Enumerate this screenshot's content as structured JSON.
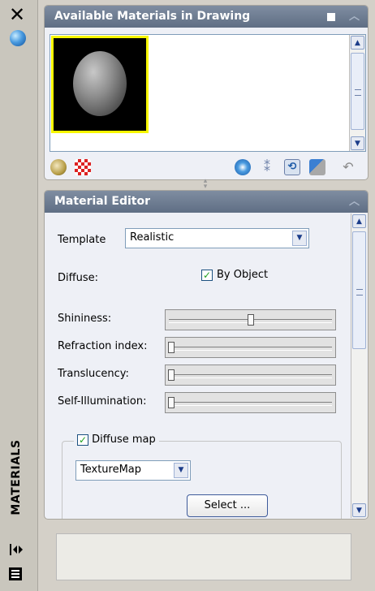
{
  "strip": {
    "close_glyph": "✕",
    "title": "MATERIALS",
    "icons": [
      "close-icon",
      "materials-globe-icon",
      "auto-hide-icon",
      "properties-menu-icon"
    ]
  },
  "available_materials": {
    "title": "Available Materials in Drawing",
    "swatch_selected": "Global",
    "accent_color": "#f7f700",
    "toolbar_icons": [
      "create-material-icon",
      "checker-icon",
      "apply-material-icon",
      "purge-icon",
      "sync-icon",
      "attach-by-layer-icon",
      "undo-icon"
    ]
  },
  "material_editor": {
    "title": "Material Editor",
    "template_label": "Template",
    "template_value": "Realistic",
    "diffuse_label": "Diffuse:",
    "by_object_label": "By Object",
    "by_object_checked": true,
    "sliders": [
      {
        "label": "Shininess:",
        "value": 0.5
      },
      {
        "label": "Refraction index:",
        "value": 0.0
      },
      {
        "label": "Translucency:",
        "value": 0.0
      },
      {
        "label": "Self-Illumination:",
        "value": 0.0
      }
    ],
    "diffuse_map_label": "Diffuse map",
    "diffuse_map_checked": true,
    "map_type_value": "TextureMap",
    "select_button_label": "Select ..."
  }
}
